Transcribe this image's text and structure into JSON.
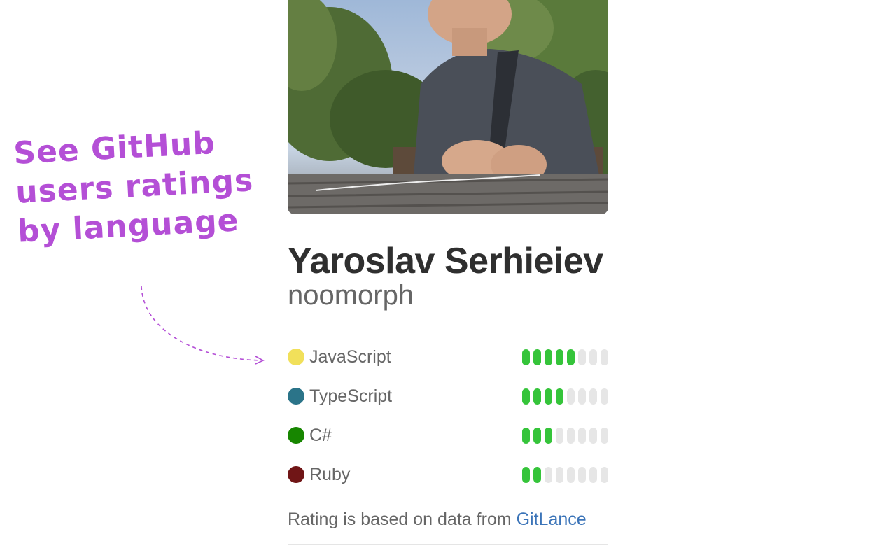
{
  "annotation": {
    "lines": [
      "See GitHub",
      "users ratings",
      "by language"
    ],
    "color": "#b44fd6"
  },
  "profile": {
    "name": "Yaroslav Serhieiev",
    "login": "noomorph"
  },
  "languages": [
    {
      "name": "JavaScript",
      "color": "#f1e05a",
      "rating": 5,
      "max": 8
    },
    {
      "name": "TypeScript",
      "color": "#2b7489",
      "rating": 4,
      "max": 8
    },
    {
      "name": "C#",
      "color": "#178600",
      "rating": 3,
      "max": 8
    },
    {
      "name": "Ruby",
      "color": "#701516",
      "rating": 2,
      "max": 8
    }
  ],
  "source": {
    "text": "Rating is based on data from",
    "link_label": "GitLance"
  },
  "colors": {
    "bar_on": "#35c43a",
    "bar_off": "#e6e6e6",
    "link": "#3b74b8"
  }
}
